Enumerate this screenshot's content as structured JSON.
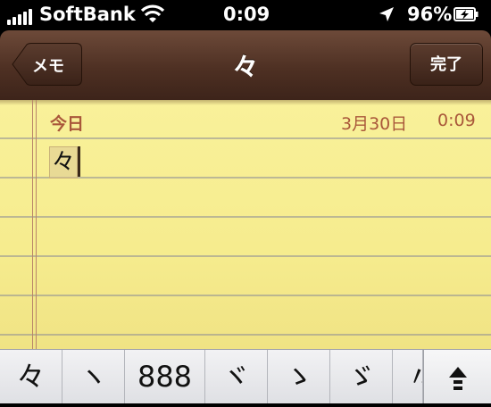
{
  "status_bar": {
    "carrier": "SoftBank",
    "time": "0:09",
    "battery_percent": "96%",
    "signal_bars": 5,
    "icons": [
      "signal-bars-icon",
      "wifi-icon",
      "location-arrow-icon",
      "battery-charging-icon"
    ]
  },
  "navbar": {
    "back_label": "メモ",
    "title": "々",
    "done_label": "完了"
  },
  "note": {
    "date_label": "今日",
    "date": "3月30日",
    "time": "0:09",
    "text": "々"
  },
  "candidates": [
    "々",
    "ヽ",
    "888",
    "ヾ",
    "ゝ",
    "ゞ",
    "〃"
  ],
  "keyboard": {
    "expand_icon": "expand-candidates-icon"
  },
  "colors": {
    "navbar": "#4e3023",
    "paper": "#f6ec8e",
    "date_text": "#a9573a",
    "rule_line": "#8c8c96"
  }
}
